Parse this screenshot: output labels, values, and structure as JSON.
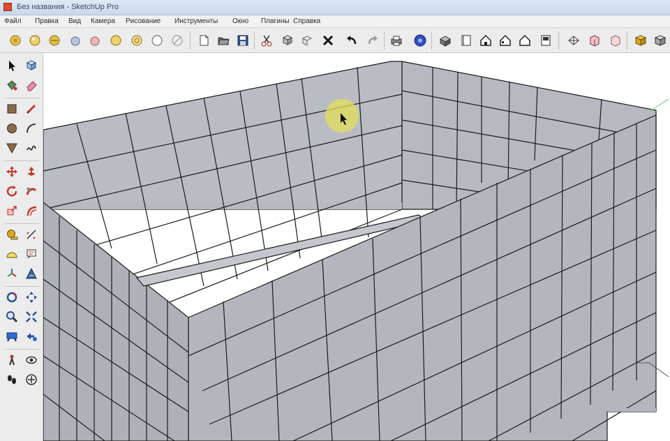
{
  "window": {
    "title": "Без названия - SketchUp Pro"
  },
  "menu": {
    "items": [
      "Файл",
      "Правка",
      "Вид",
      "Камера",
      "Рисование",
      "Инструменты",
      "Окно",
      "Плагины",
      "Справка"
    ]
  },
  "toolbar": {
    "icons": [
      "select-face-style-icon",
      "xray-icon",
      "back-edges-icon",
      "shaded-icon",
      "textured-icon",
      "monochrome-icon",
      "wireframe-icon",
      "hidden-line-icon",
      "new-file-icon",
      "open-file-icon",
      "save-icon",
      "cut-icon",
      "copy-icon",
      "paste-icon",
      "delete-icon",
      "undo-icon",
      "redo-icon",
      "print-icon",
      "model-info-icon",
      "iso-view-icon",
      "top-view-icon",
      "front-view-icon",
      "right-view-icon",
      "back-view-icon",
      "left-view-icon",
      "section-plane-icon",
      "section-cut-icon",
      "section-display-icon",
      "component-icon",
      "3d-warehouse-icon"
    ]
  },
  "side_toolbar": {
    "icons": [
      "select-arrow-icon",
      "make-component-icon",
      "paint-bucket-icon",
      "eraser-icon",
      "rectangle-icon",
      "line-pencil-icon",
      "circle-icon",
      "arc-icon",
      "polygon-icon",
      "freehand-icon",
      "move-icon",
      "push-pull-icon",
      "rotate-icon",
      "follow-me-icon",
      "scale-icon",
      "offset-icon",
      "tape-measure-icon",
      "dimension-icon",
      "protractor-icon",
      "text-icon",
      "axes-icon",
      "3d-text-icon",
      "orbit-icon",
      "pan-icon",
      "zoom-icon",
      "zoom-window-icon",
      "zoom-extents-icon",
      "previous-view-icon",
      "position-camera-icon",
      "look-around-icon",
      "walk-icon",
      "section-tool-icon"
    ]
  },
  "colors": {
    "face": "#b3b7bd",
    "face_light": "#bcc0c6",
    "face_dark": "#a9adb3",
    "edge": "#1a1a1a",
    "cursor_highlight": "#e3e05a",
    "axis_green": "#7ccf8a"
  }
}
